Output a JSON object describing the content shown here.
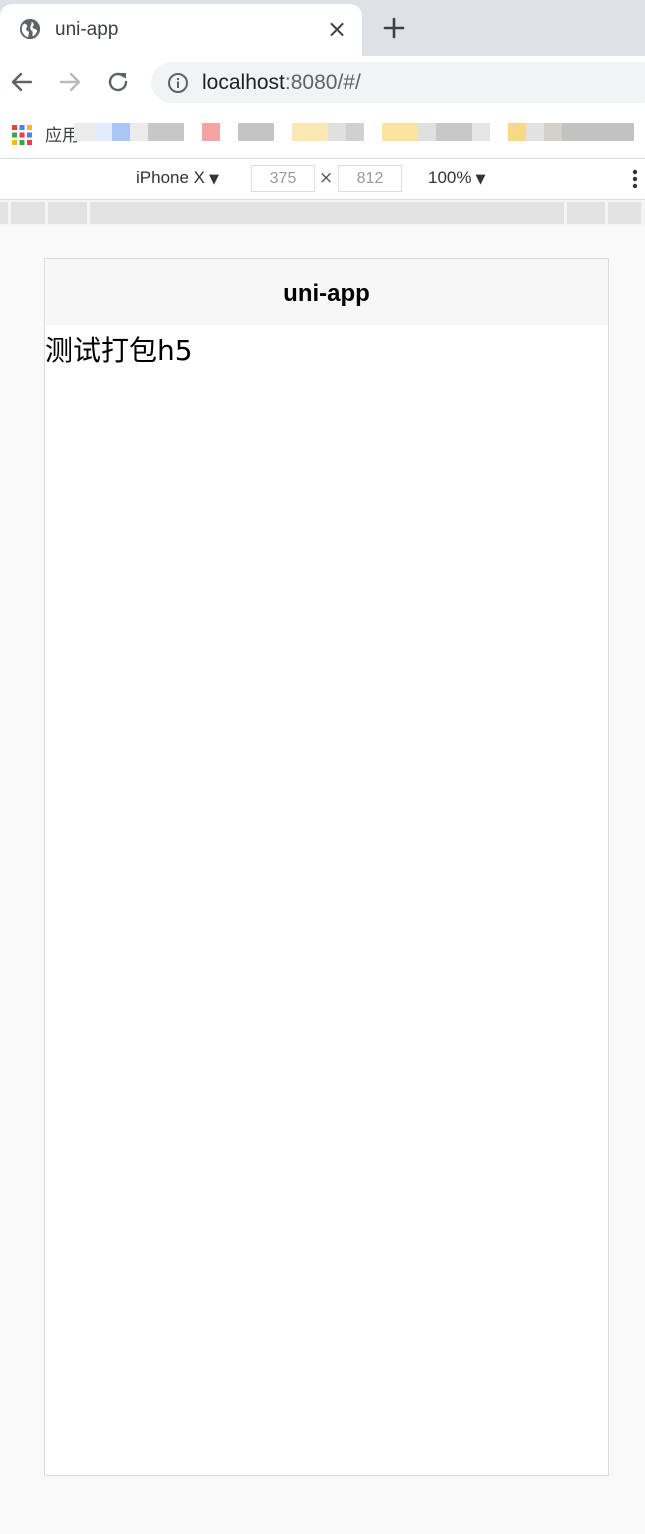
{
  "browser": {
    "tab": {
      "title": "uni-app",
      "close_label": "×",
      "favicon": "globe-icon"
    },
    "new_tab_icon": "plus-icon",
    "nav": {
      "back_icon": "arrow-left-icon",
      "forward_icon": "arrow-right-icon",
      "reload_icon": "reload-icon"
    },
    "omnibox": {
      "info_icon": "info-icon",
      "host": "localhost",
      "path": ":8080/#/"
    },
    "bookmarks": {
      "apps_label": "应用"
    }
  },
  "devtools": {
    "device": "iPhone X",
    "width": "375",
    "times": "×",
    "height": "812",
    "zoom": "100%",
    "caret": "▼"
  },
  "app": {
    "nav_title": "uni-app",
    "content_text": "测试打包h5"
  }
}
